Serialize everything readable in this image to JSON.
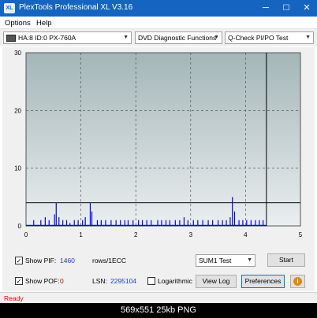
{
  "window": {
    "title": "PlexTools Professional XL V3.16",
    "icon_text": "XL",
    "minimize_glyph": "─",
    "maximize_glyph": "☐",
    "close_glyph": "✕"
  },
  "menu": {
    "items": [
      "Options",
      "Help"
    ]
  },
  "toolbar": {
    "drive": "HA:8 ID:0  PX-760A",
    "function": "DVD Diagnostic Functions",
    "test": "Q-Check PI/PO Test"
  },
  "chart_data": {
    "type": "bar",
    "x_ticks": [
      "0",
      "1",
      "2",
      "3",
      "4",
      "5"
    ],
    "y_ticks": [
      "0",
      "10",
      "20",
      "30"
    ],
    "xlim": [
      0,
      5
    ],
    "ylim": [
      0,
      30
    ],
    "threshold": 4,
    "end_marker_x": 4.38,
    "grid": true,
    "series_color": "#0000ff",
    "spikes": [
      [
        0.14,
        1
      ],
      [
        0.27,
        1
      ],
      [
        0.35,
        1.5
      ],
      [
        0.42,
        1
      ],
      [
        0.52,
        2
      ],
      [
        0.55,
        4
      ],
      [
        0.6,
        1.5
      ],
      [
        0.67,
        1
      ],
      [
        0.74,
        1
      ],
      [
        0.8,
        0.5
      ],
      [
        0.88,
        1
      ],
      [
        0.95,
        1
      ],
      [
        1.03,
        1
      ],
      [
        1.08,
        1.5
      ],
      [
        1.17,
        4
      ],
      [
        1.2,
        2.5
      ],
      [
        1.3,
        1
      ],
      [
        1.37,
        1
      ],
      [
        1.45,
        1
      ],
      [
        1.55,
        1
      ],
      [
        1.64,
        1
      ],
      [
        1.72,
        1
      ],
      [
        1.8,
        1
      ],
      [
        1.86,
        1
      ],
      [
        1.95,
        1
      ],
      [
        2.05,
        1
      ],
      [
        2.12,
        1
      ],
      [
        2.2,
        1
      ],
      [
        2.28,
        1
      ],
      [
        2.4,
        1
      ],
      [
        2.47,
        1
      ],
      [
        2.55,
        1
      ],
      [
        2.62,
        1
      ],
      [
        2.72,
        1
      ],
      [
        2.8,
        1
      ],
      [
        2.88,
        1.5
      ],
      [
        2.95,
        1
      ],
      [
        3.05,
        1
      ],
      [
        3.13,
        1
      ],
      [
        3.22,
        1
      ],
      [
        3.32,
        1
      ],
      [
        3.4,
        1
      ],
      [
        3.5,
        1
      ],
      [
        3.58,
        1
      ],
      [
        3.65,
        1
      ],
      [
        3.72,
        1.5
      ],
      [
        3.76,
        5
      ],
      [
        3.8,
        2.5
      ],
      [
        3.88,
        1
      ],
      [
        3.95,
        1
      ],
      [
        4.02,
        1
      ],
      [
        4.1,
        1
      ],
      [
        4.18,
        1
      ],
      [
        4.25,
        1
      ],
      [
        4.32,
        1
      ]
    ]
  },
  "controls": {
    "show_pif_label": "Show PIF:",
    "pif_value": "1460",
    "pif_unit": "rows/1ECC",
    "show_pof_label": "Show POF:",
    "pof_value": "0",
    "lsn_label": "LSN:",
    "lsn_value": "2295104",
    "logarithmic_label": "Logarithmic",
    "sum_mode": "SUM1 Test",
    "start_button": "Start",
    "view_log_button": "View Log",
    "preferences_button": "Preferences",
    "info_glyph": "i",
    "check_glyph": "✓",
    "pif_checked": true,
    "pof_checked": true,
    "logarithmic_checked": false
  },
  "status": {
    "text": "Ready"
  },
  "caption": {
    "text": "569x551  25kb  PNG"
  }
}
